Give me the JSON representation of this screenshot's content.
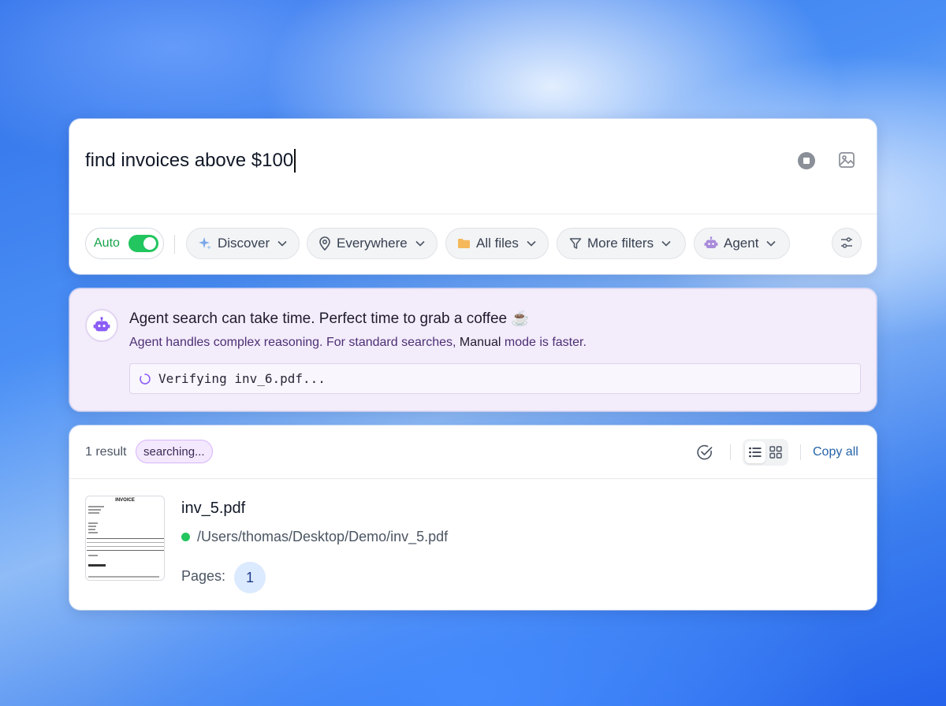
{
  "search": {
    "query": "find invoices above $100",
    "auto_label": "Auto",
    "auto_enabled": true,
    "filters": [
      {
        "label": "Discover",
        "icon": "sparkles-icon"
      },
      {
        "label": "Everywhere",
        "icon": "location-pin-icon"
      },
      {
        "label": "All files",
        "icon": "folder-icon"
      },
      {
        "label": "More filters",
        "icon": "funnel-icon"
      },
      {
        "label": "Agent",
        "icon": "robot-icon"
      }
    ]
  },
  "agent_notice": {
    "title": "Agent search can take time. Perfect time to grab a coffee ☕",
    "subtitle_prefix": "Agent handles complex reasoning. For standard searches,",
    "subtitle_mode": "Manual",
    "subtitle_suffix": "mode is faster.",
    "status": "Verifying inv_6.pdf..."
  },
  "results": {
    "count_label": "1 result",
    "state_badge": "searching...",
    "copy_all_label": "Copy all",
    "view_mode": "list",
    "items": [
      {
        "file_name": "inv_5.pdf",
        "path": "/Users/thomas/Desktop/Demo/inv_5.pdf",
        "pages_label": "Pages:",
        "pages": [
          "1"
        ],
        "status_color": "#22c55e",
        "thumbnail_title": "INVOICE"
      }
    ]
  },
  "colors": {
    "accent_green": "#22c55e",
    "agent_purple": "#8b5cf6",
    "link_blue": "#2563a8"
  }
}
